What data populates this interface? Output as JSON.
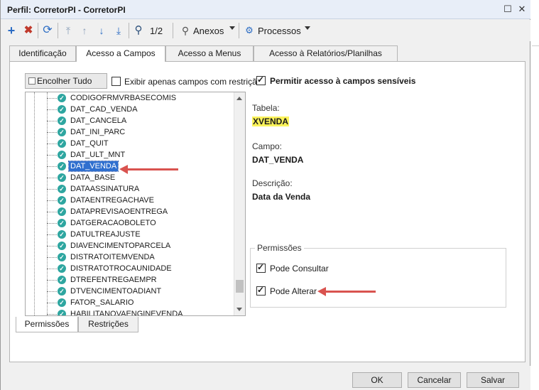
{
  "window": {
    "title": "Perfil: CorretorPI - CorretorPI"
  },
  "toolbar": {
    "pagination": "1/2",
    "anexos_label": "Anexos",
    "processos_label": "Processos"
  },
  "tabs": [
    {
      "label": "Identificação"
    },
    {
      "label": "Acesso a Campos"
    },
    {
      "label": "Acesso a Menus"
    },
    {
      "label": "Acesso à Relatórios/Planilhas"
    }
  ],
  "left": {
    "collapse_button": "Encolher Tudo",
    "restrict_checkbox_label": "Exibir apenas campos com restrição",
    "restrict_checked": false
  },
  "tree": {
    "items": [
      {
        "label": "CODIGOFRMVRBASECOMIS"
      },
      {
        "label": "DAT_CAD_VENDA"
      },
      {
        "label": "DAT_CANCELA"
      },
      {
        "label": "DAT_INI_PARC"
      },
      {
        "label": "DAT_QUIT"
      },
      {
        "label": "DAT_ULT_MNT"
      },
      {
        "label": "DAT_VENDA"
      },
      {
        "label": "DATA_BASE"
      },
      {
        "label": "DATAASSINATURA"
      },
      {
        "label": "DATAENTREGACHAVE"
      },
      {
        "label": "DATAPREVISAOENTREGA"
      },
      {
        "label": "DATGERACAOBOLETO"
      },
      {
        "label": "DATULTREAJUSTE"
      },
      {
        "label": "DIAVENCIMENTOPARCELA"
      },
      {
        "label": "DISTRATOITEMVENDA"
      },
      {
        "label": "DISTRATOTROCAUNIDADE"
      },
      {
        "label": "DTREFENTREGAEMPR"
      },
      {
        "label": "DTVENCIMENTOADIANT"
      },
      {
        "label": "FATOR_SALARIO"
      },
      {
        "label": "HABILITANOVAENGINEVENDA"
      }
    ],
    "selected_index": 6
  },
  "detail": {
    "sensitive_label": "Permitir acesso à campos sensíveis",
    "sensitive_checked": true,
    "tabela_label": "Tabela:",
    "tabela_value": "XVENDA",
    "campo_label": "Campo:",
    "campo_value": "DAT_VENDA",
    "descricao_label": "Descrição:",
    "descricao_value": "Data da Venda",
    "permissoes_title": "Permissões",
    "pode_consultar_label": "Pode Consultar",
    "pode_consultar_checked": true,
    "pode_alterar_label": "Pode Alterar",
    "pode_alterar_checked": true
  },
  "subtabs": [
    {
      "label": "Permissões"
    },
    {
      "label": "Restrições"
    }
  ],
  "buttons": {
    "ok": "OK",
    "cancel": "Cancelar",
    "save": "Salvar"
  },
  "colors": {
    "highlight": "#fbf35b",
    "selection": "#2f6fcf",
    "annotation_arrow": "#d9534f",
    "check_teal": "#2ea6a0"
  }
}
